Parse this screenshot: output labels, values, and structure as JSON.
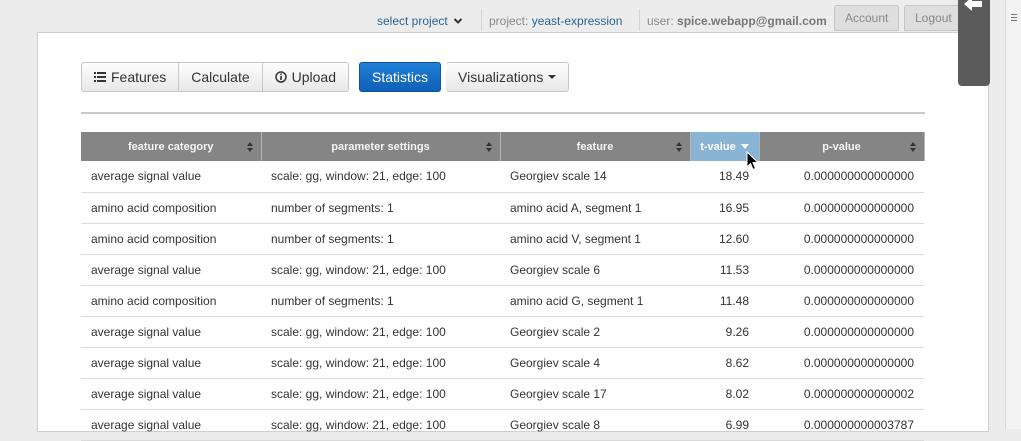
{
  "topbar": {
    "select_project": "select project",
    "project_prefix": "project: ",
    "project_name": "yeast-expression",
    "user_prefix": "user: ",
    "user_email": "spice.webapp@gmail.com",
    "account_label": "Account",
    "logout_label": "Logout"
  },
  "toolbar": {
    "features_label": "Features",
    "calculate_label": "Calculate",
    "upload_label": "Upload",
    "statistics_label": "Statistics",
    "visualizations_label": "Visualizations"
  },
  "table": {
    "columns": [
      "feature category",
      "parameter settings",
      "feature",
      "t-value",
      "p-value"
    ],
    "rows": [
      [
        "average signal value",
        "scale: gg, window: 21, edge: 100",
        "Georgiev scale 14",
        "18.49",
        "0.000000000000000"
      ],
      [
        "amino acid composition",
        "number of segments: 1",
        "amino acid A, segment 1",
        "16.95",
        "0.000000000000000"
      ],
      [
        "amino acid composition",
        "number of segments: 1",
        "amino acid V, segment 1",
        "12.60",
        "0.000000000000000"
      ],
      [
        "average signal value",
        "scale: gg, window: 21, edge: 100",
        "Georgiev scale 6",
        "11.53",
        "0.000000000000000"
      ],
      [
        "amino acid composition",
        "number of segments: 1",
        "amino acid G, segment 1",
        "11.48",
        "0.000000000000000"
      ],
      [
        "average signal value",
        "scale: gg, window: 21, edge: 100",
        "Georgiev scale 2",
        "9.26",
        "0.000000000000000"
      ],
      [
        "average signal value",
        "scale: gg, window: 21, edge: 100",
        "Georgiev scale 4",
        "8.62",
        "0.000000000000000"
      ],
      [
        "average signal value",
        "scale: gg, window: 21, edge: 100",
        "Georgiev scale 17",
        "8.02",
        "0.000000000000002"
      ],
      [
        "average signal value",
        "scale: gg, window: 21, edge: 100",
        "Georgiev scale 8",
        "6.99",
        "0.000000000003787"
      ]
    ]
  },
  "colors": {
    "accent": "#1470c8",
    "link": "#2a6496",
    "header_bg": "#858585",
    "active_header_bg": "#8ab4d4"
  },
  "icons": [
    "chevron-down-icon",
    "list-icon",
    "info-circle-icon",
    "caret-down-icon",
    "sort-both-icon",
    "sort-desc-icon",
    "back-arrow-icon",
    "mouse-cursor-icon"
  ]
}
